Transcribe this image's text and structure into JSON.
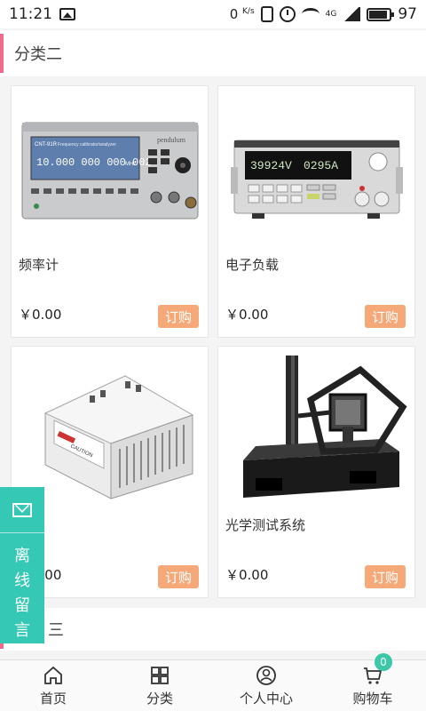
{
  "status_bar": {
    "time": "11:21",
    "speed": "0",
    "speed_unit": "K/s",
    "network": "4G",
    "battery": "97"
  },
  "section1": {
    "title": "分类二"
  },
  "section2": {
    "title_partial": "三"
  },
  "products": [
    {
      "name": "频率计",
      "price": "￥0.00",
      "order_label": "订购",
      "image": "frequency-counter",
      "display_text": "10.000 000 000 002",
      "unit": "MHz",
      "brand": "pendulum",
      "model": "CNT-91R",
      "subtitle": "Frequency calibrator/analyzer"
    },
    {
      "name": "电子负载",
      "price": "￥0.00",
      "order_label": "订购",
      "image": "electronic-load",
      "display_left": "39924V",
      "display_right": "0295A"
    },
    {
      "name": "",
      "price": "￥0.00",
      "order_label": "订购",
      "image": "din-rail-power-supply",
      "label": "CAUTION"
    },
    {
      "name": "光学测试系统",
      "price": "￥0.00",
      "order_label": "订购",
      "image": "optical-test-system"
    }
  ],
  "float_message": {
    "icon": "mail-icon",
    "chars": [
      "离",
      "线",
      "留",
      "言"
    ]
  },
  "nav": {
    "items": [
      {
        "label": "首页",
        "icon": "home-icon"
      },
      {
        "label": "分类",
        "icon": "grid-icon"
      },
      {
        "label": "个人中心",
        "icon": "user-icon"
      },
      {
        "label": "购物车",
        "icon": "cart-icon"
      }
    ],
    "cart_count": "0"
  },
  "colors": {
    "accent": "#f06b8a",
    "order_button": "#f5a878",
    "float": "#35c9b5",
    "badge": "#3cc7a6"
  }
}
